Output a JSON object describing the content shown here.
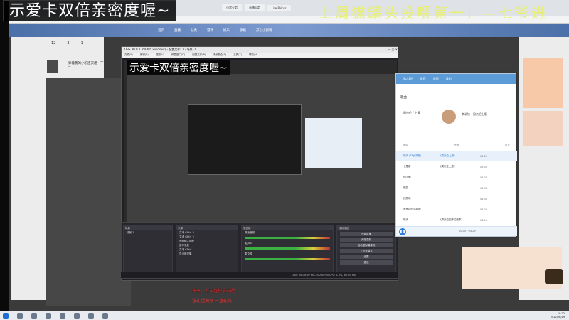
{
  "overlay": {
    "top_left": "示爱卡双倍亲密度喔~",
    "top_right": "上周猫罐头投喂第一！—七爷进",
    "inner_preview": "示爱卡双倍亲密度喔~"
  },
  "browser": {
    "tabs": [
      "",
      "小黑火箭",
      "直播火箭",
      "Life Points"
    ]
  },
  "site_nav": [
    "首页",
    "直播",
    "分类",
    "游戏",
    "娱乐",
    "手机",
    "开心小剧场"
  ],
  "obs": {
    "title": "OBS 30.0.0 (64-bit, windows) - 配置文件: 1 - 场景: 1",
    "menu": [
      "文件(F)",
      "编辑(E)",
      "视图(V)",
      "停靠窗口(D)",
      "配置文件(P)",
      "场景集合(S)",
      "工具(T)",
      "帮助(H)"
    ],
    "panels": {
      "scenes": "场景",
      "sources": "来源",
      "mixer": "混音器",
      "transitions": "转场特效",
      "controls": "控制按钮"
    },
    "scene_items": [
      "场景 1"
    ],
    "source_items": [
      "文本 GDI+ 3",
      "文本 GDI+ 2",
      "音频输入捕获",
      "窗口采集",
      "文本 GDI+",
      "显示器采集"
    ],
    "mixer_channels": [
      "桌面音频",
      "麦/Aux",
      "麦克风"
    ],
    "control_buttons": [
      "开始直播",
      "开始录制",
      "启动虚拟摄像机",
      "工作室模式",
      "设置",
      "退出"
    ],
    "status": "LIVE: 00:00:00  REC: 00:00:00  CPU: 1.3%, 60.00 fps"
  },
  "music": {
    "tabs": [
      "私人FM",
      "推荐",
      "乐馆",
      "我的"
    ],
    "section_title": "歌曲",
    "artist_a": "周杰伦 / 上瘾",
    "artist_b": "李昶铉 · 周杰伦上瘾",
    "columns": [
      "歌曲",
      "专辑",
      "时长"
    ],
    "songs": [
      {
        "title": "晴天 (TF女孩版)",
        "album": "《周杰伦上瘾》",
        "duration": "04:29",
        "active": true
      },
      {
        "title": "七里香",
        "album": "《周杰伦上瘾》",
        "duration": "05:00",
        "active": false
      },
      {
        "title": "你小偏",
        "album": "",
        "duration": "04:27",
        "active": false
      },
      {
        "title": "夜曲",
        "album": "",
        "duration": "04:36",
        "active": false
      },
      {
        "title": "红颜劫",
        "album": "",
        "duration": "04:05",
        "active": false
      },
      {
        "title": "我是真的心动吧",
        "album": "",
        "duration": "04:25",
        "active": false
      },
      {
        "title": "晴天",
        "album": "《周杰伦的床边故事》",
        "duration": "04:11",
        "active": false
      }
    ],
    "time": "00:00 / 04:29"
  },
  "captions": {
    "line1": "快来，上次赶快拿卡喔！",
    "line2": "送礼超满分  一直在线！"
  },
  "left_counts": [
    "12",
    "3",
    "1"
  ],
  "left_user_text": "穿着我的小粉连衣裙一下~",
  "clock": {
    "time": "18:22",
    "date": "2022/06/19"
  }
}
